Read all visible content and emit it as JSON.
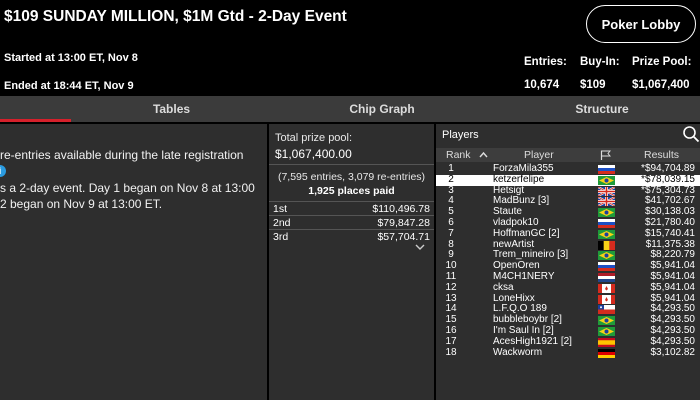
{
  "header": {
    "title": "$109 SUNDAY MILLION, $1M Gtd - 2-Day Event",
    "started": "Started at 13:00 ET, Nov 8",
    "ended": "Ended at 18:44 ET, Nov 9",
    "lobby_button": "Poker Lobby",
    "stats": [
      {
        "label": "Entries:",
        "value": "10,674"
      },
      {
        "label": "Buy-In:",
        "value": "$109"
      },
      {
        "label": "Prize Pool:",
        "value": "$1,067,400"
      }
    ]
  },
  "tabs": [
    {
      "label": "Tables",
      "active": true
    },
    {
      "label": "Chip Graph",
      "active": false
    },
    {
      "label": "Structure",
      "active": false
    }
  ],
  "description": {
    "lines": [
      "re-entries available during the late registration",
      "",
      "s a 2-day event. Day 1 began on Nov 8 at 13:00",
      "2 began on Nov 9 at 13:00 ET."
    ],
    "info_icon": "info-icon"
  },
  "prize": {
    "label": "Total prize pool:",
    "value": "$1,067,400.00",
    "entries_detail": "(7,595 entries, 3,079 re-entries)",
    "places_paid": "1,925 places paid",
    "payouts": [
      {
        "place": "1st",
        "amount": "$110,496.78"
      },
      {
        "place": "2nd",
        "amount": "$79,847.28"
      },
      {
        "place": "3rd",
        "amount": "$57,704.71"
      }
    ]
  },
  "players": {
    "title": "Players",
    "columns": {
      "rank": "Rank",
      "player": "Player",
      "results": "Results"
    },
    "selected_rank": "2",
    "rows": [
      {
        "rank": "1",
        "name": "ForzaMila355",
        "flag": "russia",
        "result": "*$94,704.89"
      },
      {
        "rank": "2",
        "name": "ketzerfelipe",
        "flag": "brazil",
        "result": "*$78,039.15"
      },
      {
        "rank": "3",
        "name": "Hetsigt",
        "flag": "uk",
        "result": "*$75,304.73"
      },
      {
        "rank": "4",
        "name": "MadBunz [3]",
        "flag": "uk",
        "result": "$41,702.67"
      },
      {
        "rank": "5",
        "name": "Staute",
        "flag": "brazil",
        "result": "$30,138.03"
      },
      {
        "rank": "6",
        "name": "vladpok10",
        "flag": "russia",
        "result": "$21,780.40"
      },
      {
        "rank": "7",
        "name": "HoffmanGC [2]",
        "flag": "brazil",
        "result": "$15,740.41"
      },
      {
        "rank": "8",
        "name": "newArtist",
        "flag": "belgium",
        "result": "$11,375.38"
      },
      {
        "rank": "9",
        "name": "Trem_mineiro [3]",
        "flag": "brazil",
        "result": "$8,220.79"
      },
      {
        "rank": "10",
        "name": "OpenOren",
        "flag": "russia",
        "result": "$5,941.04"
      },
      {
        "rank": "11",
        "name": "M4CH1NERY",
        "flag": "netherlands",
        "result": "$5,941.04"
      },
      {
        "rank": "12",
        "name": "cksa",
        "flag": "canada",
        "result": "$5,941.04"
      },
      {
        "rank": "13",
        "name": "LoneHixx",
        "flag": "canada",
        "result": "$5,941.04"
      },
      {
        "rank": "14",
        "name": "L.F.Q.O 189",
        "flag": "chile",
        "result": "$4,293.50"
      },
      {
        "rank": "15",
        "name": "bubbleboybr [2]",
        "flag": "brazil",
        "result": "$4,293.50"
      },
      {
        "rank": "16",
        "name": "I'm Saul In [2]",
        "flag": "brazil",
        "result": "$4,293.50"
      },
      {
        "rank": "17",
        "name": "AcesHigh1921 [2]",
        "flag": "spain",
        "result": "$4,293.50"
      },
      {
        "rank": "18",
        "name": "Wackworm",
        "flag": "germany",
        "result": "$3,102.82"
      }
    ]
  },
  "colors": {
    "accent": "#d6202b",
    "panel_bg": "#2e2e2e",
    "tab_bg": "#3b3b3b",
    "info": "#2a9be0"
  }
}
